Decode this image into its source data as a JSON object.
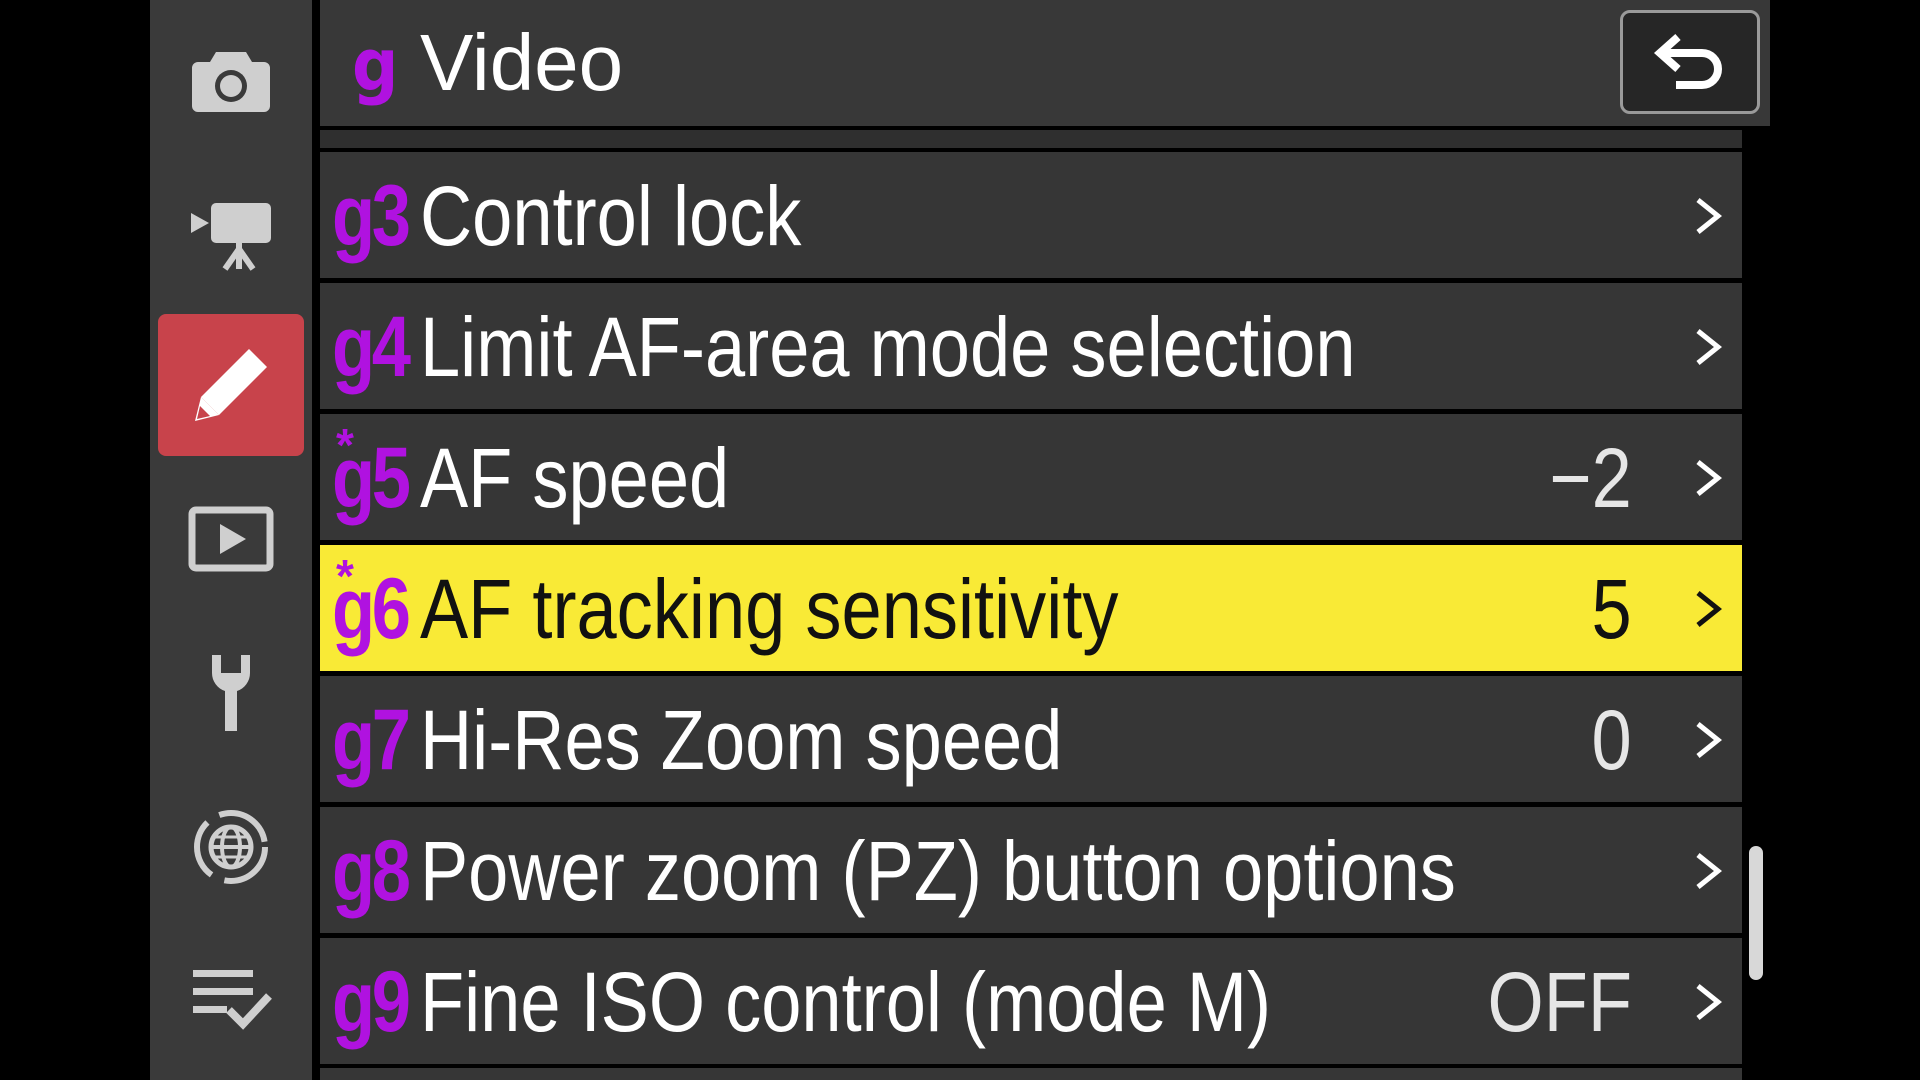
{
  "header": {
    "menu_code": "g",
    "title": "Video",
    "back_icon": "return-icon"
  },
  "rail": {
    "tabs": [
      {
        "icon": "photo-camera-icon",
        "active": false
      },
      {
        "icon": "movie-camera-icon",
        "active": false
      },
      {
        "icon": "pencil-icon",
        "active": true
      },
      {
        "icon": "playback-icon",
        "active": false
      },
      {
        "icon": "wrench-icon",
        "active": false
      },
      {
        "icon": "network-globe-icon",
        "active": false
      },
      {
        "icon": "my-menu-list-icon",
        "active": false
      }
    ]
  },
  "rows": [
    {
      "code": "g3",
      "modified": false,
      "label": "Control lock",
      "value": "",
      "selected": false
    },
    {
      "code": "g4",
      "modified": false,
      "label": "Limit AF-area mode selection",
      "value": "",
      "selected": false
    },
    {
      "code": "g5",
      "modified": true,
      "label": "AF speed",
      "value": "−2",
      "selected": false
    },
    {
      "code": "g6",
      "modified": true,
      "label": "AF tracking sensitivity",
      "value": "5",
      "selected": true
    },
    {
      "code": "g7",
      "modified": false,
      "label": "Hi-Res Zoom speed",
      "value": "0",
      "selected": false
    },
    {
      "code": "g8",
      "modified": false,
      "label": "Power zoom (PZ) button options",
      "value": "",
      "selected": false
    },
    {
      "code": "g9",
      "modified": false,
      "label": "Fine ISO control (mode M)",
      "value": "OFF",
      "selected": false
    }
  ],
  "modified_marker": "*",
  "colors": {
    "accent_code": "#b012e0",
    "selected_row": "#f9ea36",
    "active_tab": "#c8434b"
  },
  "scroll": {
    "position": 0.9
  }
}
